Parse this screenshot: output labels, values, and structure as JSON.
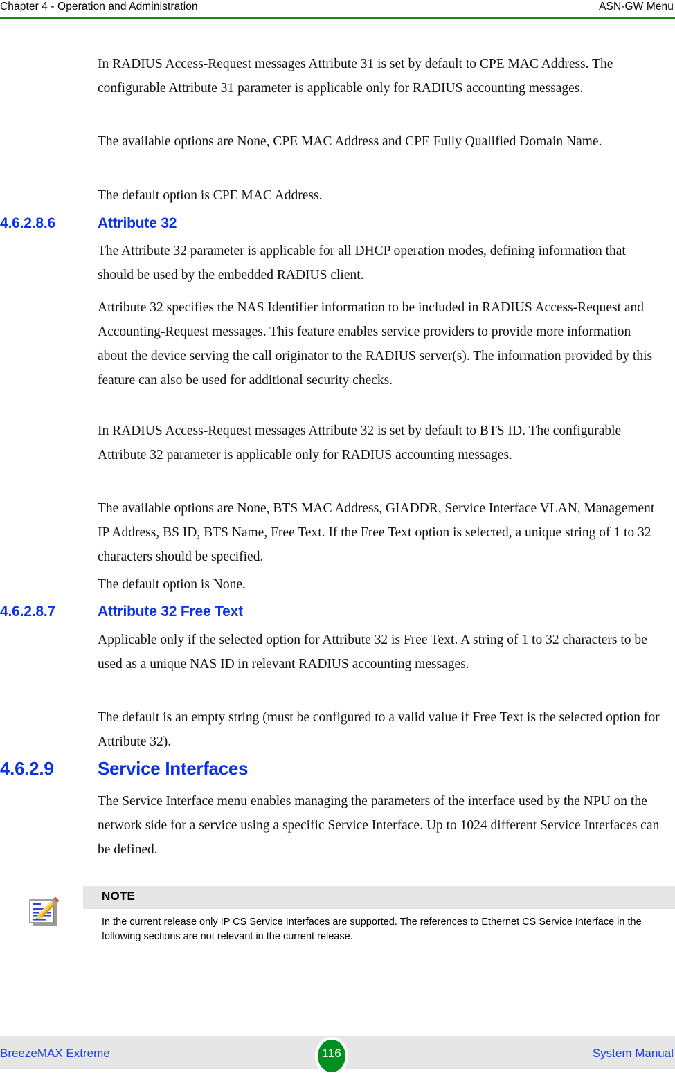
{
  "header": {
    "left": "Chapter 4 - Operation and Administration",
    "right": "ASN-GW Menu",
    "rule_color": "#0e8a0e"
  },
  "colors": {
    "heading_blue": "#0a32e8",
    "footer_link_blue": "#1a3ef0",
    "note_band_gray": "#e6e6e6",
    "badge_green": "#00901f",
    "rule_green": "#0e8a0e"
  },
  "blocks": [
    {
      "type": "paragraph",
      "text": "In RADIUS Access-Request messages Attribute 31 is set by default to CPE MAC Address. The configurable Attribute 31 parameter is applicable only for RADIUS accounting messages."
    },
    {
      "type": "paragraph",
      "text": "The available options are None, CPE MAC Address and CPE Fully Qualified Domain Name."
    },
    {
      "type": "paragraph",
      "text": "The default option is CPE MAC Address."
    },
    {
      "type": "heading4",
      "number": "4.6.2.8.6",
      "title": "Attribute 32"
    },
    {
      "type": "paragraph",
      "text": "The Attribute 32 parameter is applicable for all DHCP operation modes, defining information that should be used by the embedded RADIUS client."
    },
    {
      "type": "paragraph",
      "text": "Attribute 32 specifies the NAS Identifier information to be included in RADIUS Access-Request and Accounting-Request messages. This feature enables service providers to provide more information about the device serving the call originator to the RADIUS server(s). The information provided by this feature can also be used for additional security checks."
    },
    {
      "type": "paragraph",
      "text": "In RADIUS Access-Request messages Attribute 32 is set by default to BTS ID. The configurable Attribute 32 parameter is applicable only for RADIUS accounting messages."
    },
    {
      "type": "paragraph",
      "text": "The available options are None, BTS MAC Address, GIADDR, Service Interface VLAN, Management IP Address, BS ID, BTS Name, Free Text. If the Free Text option is selected, a unique string of 1 to 32 characters should be specified."
    },
    {
      "type": "paragraph",
      "text": "The default option is None."
    },
    {
      "type": "heading4",
      "number": "4.6.2.8.7",
      "title": "Attribute 32 Free Text"
    },
    {
      "type": "paragraph",
      "text": "Applicable only if the selected option for Attribute 32 is Free Text. A string of 1 to 32 characters to be used as a unique NAS ID in relevant RADIUS accounting messages."
    },
    {
      "type": "paragraph",
      "text": "The default is an empty string (must be configured to a valid value if Free Text is the selected option for Attribute 32)."
    },
    {
      "type": "heading3",
      "number": "4.6.2.9",
      "title": "Service Interfaces"
    },
    {
      "type": "paragraph",
      "text": "The Service Interface menu enables managing the parameters of the interface used by the NPU on the network side for a service using a specific Service Interface. Up to 1024 different Service Interfaces can be defined."
    }
  ],
  "note": {
    "icon": "notepad-pencil-icon",
    "title": "NOTE",
    "body": "In the current release only IP CS Service Interfaces are supported. The references to Ethernet CS Service Interface in the following sections are not relevant in the current release."
  },
  "footer": {
    "left": "BreezeMAX Extreme",
    "page_number": "116",
    "right": "System Manual"
  }
}
